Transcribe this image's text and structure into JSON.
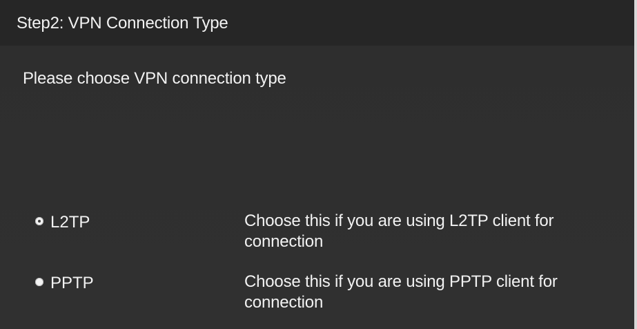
{
  "header": {
    "title": "Step2: VPN Connection Type"
  },
  "prompt": "Please choose VPN connection type",
  "options": [
    {
      "name": "L2TP",
      "description": "Choose this if you are using L2TP client for connection",
      "selected": true
    },
    {
      "name": "PPTP",
      "description": "Choose this if you are using PPTP client for connection",
      "selected": false
    }
  ],
  "colors": {
    "background": "#2f2f2f",
    "header_background": "#262626",
    "text": "#f2f2f2",
    "right_strip": "#d8d8d8"
  }
}
